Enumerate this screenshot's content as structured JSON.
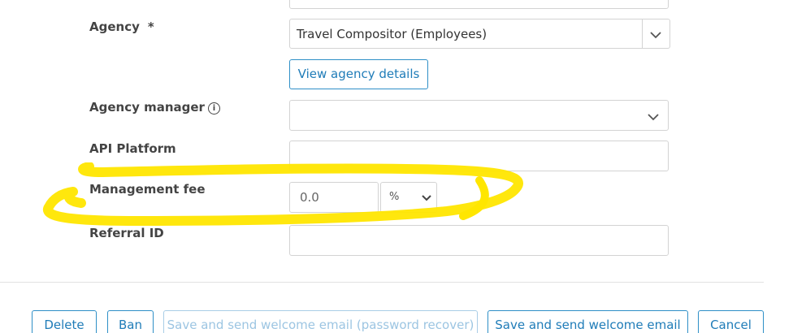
{
  "form": {
    "agency": {
      "label": "Agency",
      "required_mark": "*",
      "selected": "Travel Compositor (Employees)",
      "view_details_label": "View agency details"
    },
    "agency_manager": {
      "label": "Agency manager",
      "info_icon": "i",
      "selected": ""
    },
    "api_platform": {
      "label": "API Platform",
      "value": ""
    },
    "management_fee": {
      "label": "Management fee",
      "placeholder": "0.0",
      "unit": "%"
    },
    "referral_id": {
      "label": "Referral ID",
      "value": ""
    }
  },
  "actions": {
    "delete_label": "Delete",
    "ban_label": "Ban",
    "save_recover_label": "Save and send welcome email (password recover)",
    "save_welcome_label": "Save and send welcome email",
    "cancel_label": "Cancel"
  },
  "colors": {
    "accent": "#2e8fc7",
    "highlight": "#ffe600"
  }
}
